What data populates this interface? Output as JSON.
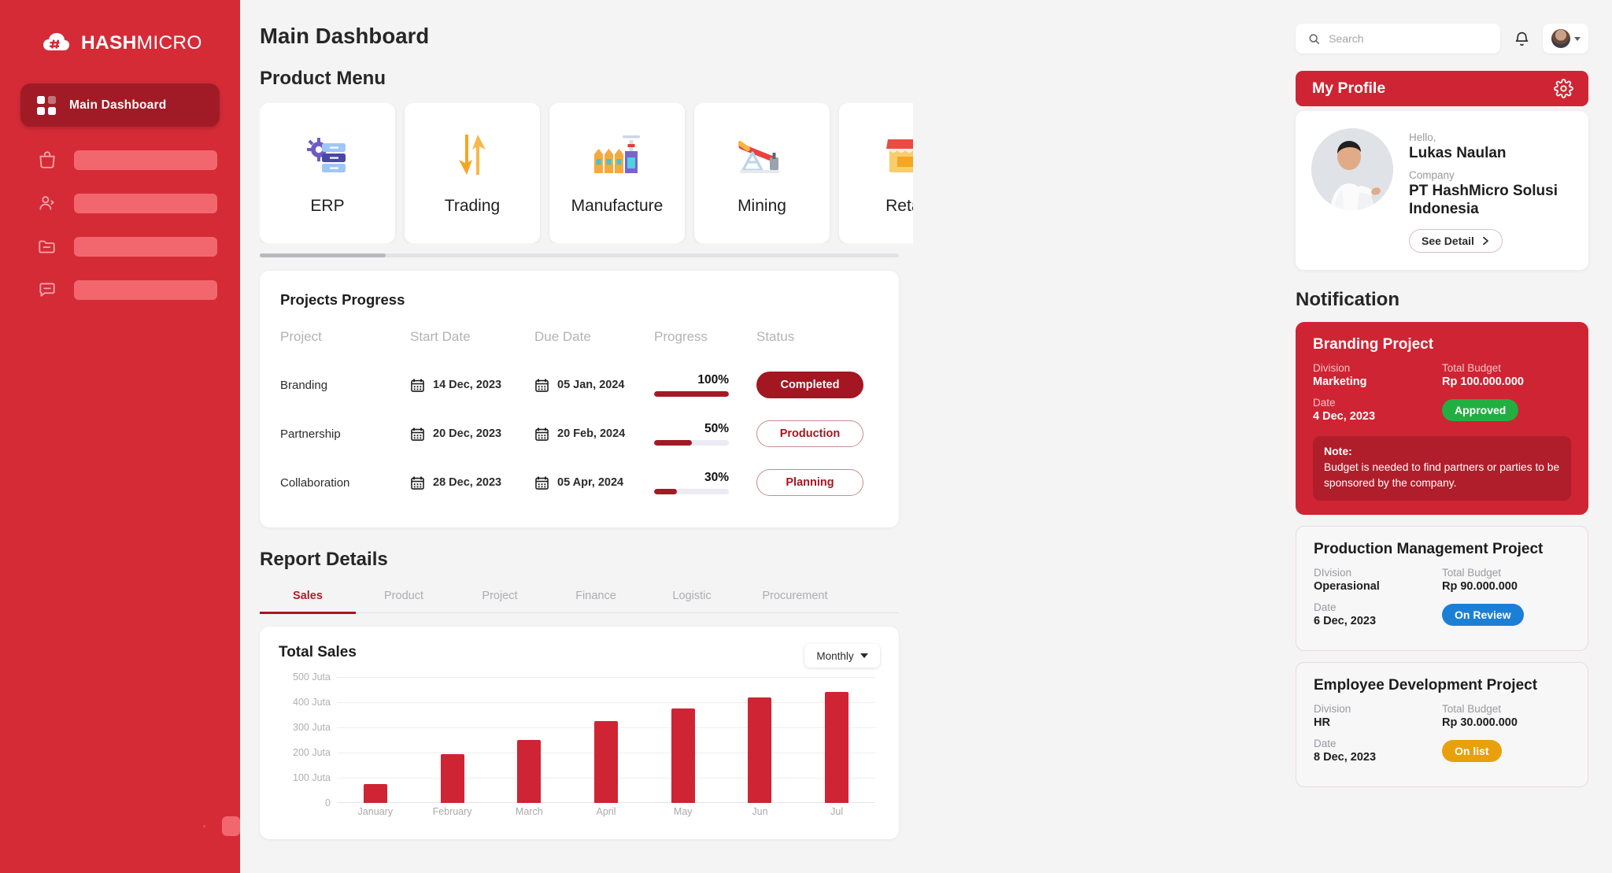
{
  "sidebar": {
    "logo": {
      "bold": "HASH",
      "light": "MICRO"
    },
    "active_item": "Main Dashboard",
    "placeholder_items": [
      "",
      "",
      "",
      ""
    ]
  },
  "main": {
    "page_title": "Main Dashboard",
    "product_menu_title": "Product Menu",
    "products": [
      {
        "label": "ERP",
        "icon": "gear-server-icon"
      },
      {
        "label": "Trading",
        "icon": "arrows-updown-icon"
      },
      {
        "label": "Manufacture",
        "icon": "factory-icon"
      },
      {
        "label": "Mining",
        "icon": "oil-pump-icon"
      },
      {
        "label": "Retail",
        "icon": "store-icon"
      }
    ],
    "projects": {
      "title": "Projects Progress",
      "columns": [
        "Project",
        "Start Date",
        "Due Date",
        "Progress",
        "Status"
      ],
      "rows": [
        {
          "project": "Branding",
          "start": "14 Dec, 2023",
          "due": "05 Jan, 2024",
          "progress": "100%",
          "progress_value": 100,
          "status": "Completed",
          "status_style": "filled"
        },
        {
          "project": "Partnership",
          "start": "20 Dec, 2023",
          "due": "20 Feb, 2024",
          "progress": "50%",
          "progress_value": 50,
          "status": "Production",
          "status_style": "outline"
        },
        {
          "project": "Collaboration",
          "start": "28 Dec, 2023",
          "due": "05 Apr, 2024",
          "progress": "30%",
          "progress_value": 30,
          "status": "Planning",
          "status_style": "outline"
        }
      ]
    },
    "report": {
      "title": "Report Details",
      "tabs": [
        {
          "label": "Sales",
          "active": true
        },
        {
          "label": "Product",
          "active": false
        },
        {
          "label": "Project",
          "active": false
        },
        {
          "label": "Finance",
          "active": false
        },
        {
          "label": "Logistic",
          "active": false
        },
        {
          "label": "Procurement",
          "active": false
        }
      ],
      "dropdown_value": "Monthly"
    }
  },
  "chart_data": {
    "type": "bar",
    "title": "Total Sales",
    "categories": [
      "January",
      "February",
      "March",
      "April",
      "May",
      "Jun",
      "Jul"
    ],
    "values": [
      75,
      195,
      250,
      325,
      375,
      420,
      440
    ],
    "ytick_labels": [
      "0",
      "100 Juta",
      "200 Juta",
      "300 Juta",
      "400 Juta",
      "500 Juta"
    ],
    "ytick_values": [
      0,
      100,
      200,
      300,
      400,
      500
    ],
    "ylim": [
      0,
      500
    ],
    "xlabel": "",
    "ylabel": "",
    "grid": true,
    "legend": "none",
    "bar_color": "#cf2433"
  },
  "right": {
    "search_placeholder": "Search",
    "profile_header": "My Profile",
    "profile": {
      "greeting": "Hello,",
      "name": "Lukas Naulan",
      "company_label": "Company",
      "company": "PT HashMicro Solusi Indonesia",
      "see_detail": "See Detail"
    },
    "notification_title": "Notification",
    "notifications": [
      {
        "title": "Branding Project",
        "division_label": "Division",
        "division": "Marketing",
        "budget_label": "Total Budget",
        "budget": "Rp 100.000.000",
        "date_label": "Date",
        "date": "4 Dec, 2023",
        "status": "Approved",
        "status_color": "#21af41",
        "style": "red",
        "note_label": "Note:",
        "note": "Budget is needed to find partners or parties to be sponsored by the company."
      },
      {
        "title": "Production Management Project",
        "division_label": "DIvision",
        "division": "Operasional",
        "budget_label": "Total Budget",
        "budget": "Rp 90.000.000",
        "date_label": "Date",
        "date": "6 Dec, 2023",
        "status": "On Review",
        "status_color": "#1c7fd6",
        "style": "plain",
        "note_label": "",
        "note": ""
      },
      {
        "title": "Employee Development Project",
        "division_label": "Division",
        "division": "HR",
        "budget_label": "Total Budget",
        "budget": "Rp 30.000.000",
        "date_label": "Date",
        "date": "8 Dec, 2023",
        "status": "On list",
        "status_color": "#e9a00d",
        "style": "plain",
        "note_label": "",
        "note": ""
      }
    ]
  },
  "colors": {
    "brand_red": "#d52b37",
    "dark_red": "#a01b26",
    "accent": "#cf2433"
  }
}
